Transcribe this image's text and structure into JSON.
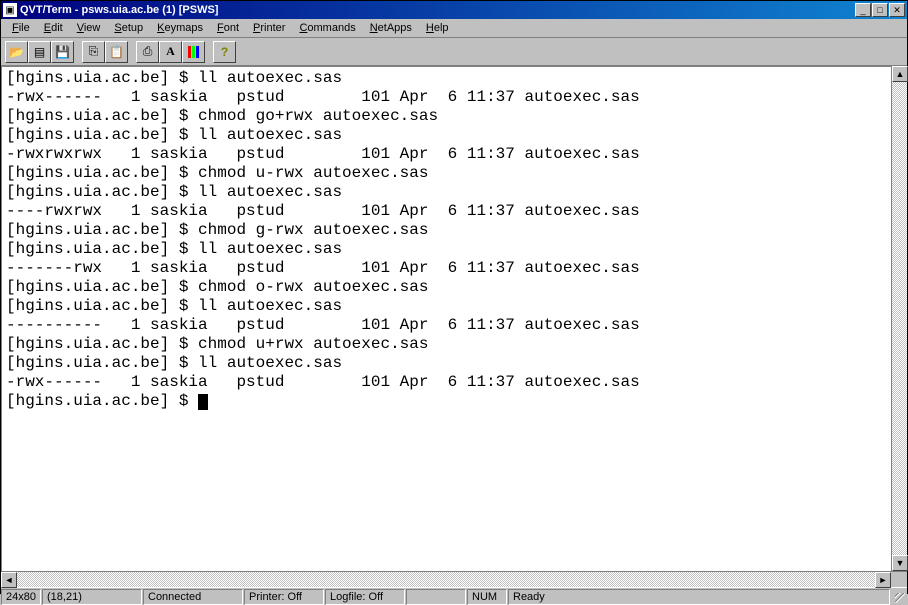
{
  "window": {
    "title": "QVT/Term - psws.uia.ac.be (1) [PSWS]"
  },
  "menu": {
    "items": [
      "File",
      "Edit",
      "View",
      "Setup",
      "Keymaps",
      "Font",
      "Printer",
      "Commands",
      "NetApps",
      "Help"
    ]
  },
  "toolbar": {
    "buttons": [
      {
        "name": "open",
        "glyph": "📂"
      },
      {
        "name": "new",
        "glyph": "▤"
      },
      {
        "name": "save",
        "glyph": "💾"
      },
      {
        "name": "copy",
        "glyph": "⎘"
      },
      {
        "name": "paste",
        "glyph": "📋"
      },
      {
        "name": "print",
        "glyph": "⎙"
      },
      {
        "name": "font",
        "glyph": "A"
      },
      {
        "name": "colors",
        "glyph": ""
      },
      {
        "name": "help",
        "glyph": "?"
      }
    ]
  },
  "terminal": {
    "lines": [
      "[hgins.uia.ac.be] $ ll autoexec.sas",
      "-rwx------   1 saskia   pstud        101 Apr  6 11:37 autoexec.sas",
      "[hgins.uia.ac.be] $ chmod go+rwx autoexec.sas",
      "[hgins.uia.ac.be] $ ll autoexec.sas",
      "-rwxrwxrwx   1 saskia   pstud        101 Apr  6 11:37 autoexec.sas",
      "[hgins.uia.ac.be] $ chmod u-rwx autoexec.sas",
      "[hgins.uia.ac.be] $ ll autoexec.sas",
      "----rwxrwx   1 saskia   pstud        101 Apr  6 11:37 autoexec.sas",
      "[hgins.uia.ac.be] $ chmod g-rwx autoexec.sas",
      "[hgins.uia.ac.be] $ ll autoexec.sas",
      "-------rwx   1 saskia   pstud        101 Apr  6 11:37 autoexec.sas",
      "[hgins.uia.ac.be] $ chmod o-rwx autoexec.sas",
      "[hgins.uia.ac.be] $ ll autoexec.sas",
      "----------   1 saskia   pstud        101 Apr  6 11:37 autoexec.sas",
      "[hgins.uia.ac.be] $ chmod u+rwx autoexec.sas",
      "[hgins.uia.ac.be] $ ll autoexec.sas",
      "-rwx------   1 saskia   pstud        101 Apr  6 11:37 autoexec.sas",
      "[hgins.uia.ac.be] $ "
    ]
  },
  "status": {
    "size": "24x80",
    "cursor": "(18,21)",
    "connection": "Connected",
    "printer": "Printer: Off",
    "logfile": "Logfile: Off",
    "blank": "",
    "numlock": "NUM",
    "ready": "Ready"
  }
}
